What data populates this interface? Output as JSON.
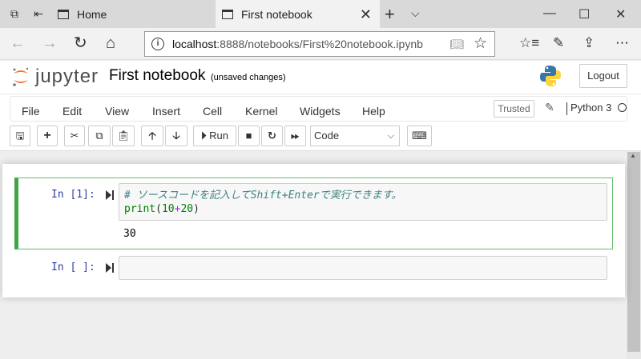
{
  "browser": {
    "tabs": [
      {
        "label": "Home"
      },
      {
        "label": "First notebook"
      }
    ],
    "address": {
      "url_host": "localhost",
      "url_rest": ":8888/notebooks/First%20notebook.ipynb"
    }
  },
  "header": {
    "logo_text": "jupyter",
    "notebook_title": "First notebook",
    "save_status": "(unsaved changes)",
    "logout_label": "Logout"
  },
  "menu": {
    "items": [
      "File",
      "Edit",
      "View",
      "Insert",
      "Cell",
      "Kernel",
      "Widgets",
      "Help"
    ],
    "trusted_label": "Trusted",
    "kernel_name": "Python 3"
  },
  "toolbar": {
    "run_label": "Run",
    "cell_type": "Code"
  },
  "cells": [
    {
      "prompt": "In [1]:",
      "code_comment": "# ソースコードを記入してShift+Enterで実行できます。",
      "code_line2": {
        "func": "print",
        "open": "(",
        "a": "10",
        "op": "+",
        "b": "20",
        "close": ")"
      },
      "output": "30"
    },
    {
      "prompt": "In [ ]:",
      "code_comment": "",
      "output": ""
    }
  ]
}
